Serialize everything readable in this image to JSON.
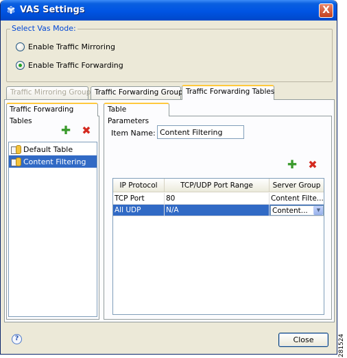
{
  "window": {
    "title": "VAS Settings",
    "close_glyph": "X",
    "app_icon": "vas-logo-icon"
  },
  "mode_group": {
    "label": "Select Vas Mode:",
    "options": [
      {
        "label": "Enable Traffic Mirroring",
        "checked": false
      },
      {
        "label": "Enable Traffic Forwarding",
        "checked": true
      }
    ]
  },
  "top_tabs": [
    {
      "label": "Traffic Mirroring Groups",
      "state": "disabled"
    },
    {
      "label": "Traffic Forwarding Groups",
      "state": "normal"
    },
    {
      "label": "Traffic Forwarding Tables",
      "state": "active"
    }
  ],
  "list_pane": {
    "tab_label": "Traffic Forwarding Tables",
    "items": [
      {
        "label": "Default Table",
        "selected": false
      },
      {
        "label": "Content Filtering",
        "selected": true
      }
    ]
  },
  "params_pane": {
    "tab_label": "Table Parameters",
    "item_name_label": "Item Name:",
    "item_name_value": "Content Filtering",
    "table": {
      "headers": [
        "IP Protocol",
        "TCP/UDP Port Range",
        "Server Group"
      ],
      "rows": [
        {
          "protocol": "TCP Port",
          "port_range": "80",
          "server_group": "Content Filte...",
          "selected": false
        },
        {
          "protocol": "All UDP",
          "port_range": "N/A",
          "server_group": "Content...",
          "selected": true
        }
      ]
    }
  },
  "footer": {
    "help_glyph": "?",
    "close_label": "Close"
  },
  "figure_code": "281524",
  "colors": {
    "titlebar": "#0054e3",
    "selection": "#316ac5",
    "add_icon": "#3a9a2c",
    "delete_icon": "#d42a20",
    "group_label": "#0046d5"
  }
}
